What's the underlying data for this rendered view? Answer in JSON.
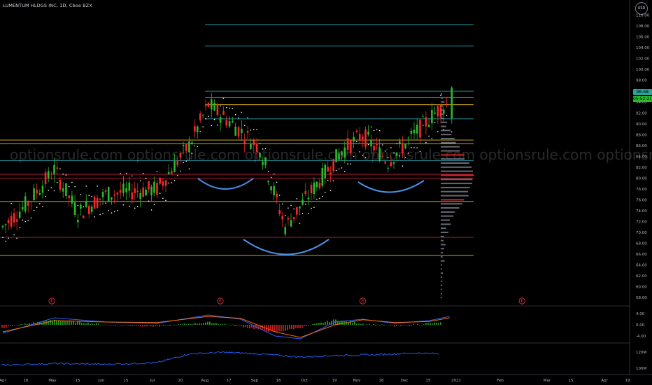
{
  "header": {
    "title": "LUMENTUM HLDGS INC, 1D, Cboe BZX",
    "currency": "USD"
  },
  "price_tags": {
    "last": "96.68",
    "countdown": "05:52:21"
  },
  "watermark": "optionsrule.com optionsrule.com optionsrule.com optionsrule.com optionsrule.com optionsrule.com opti",
  "colors": {
    "up": "#26a69a",
    "up_bright": "#2db92d",
    "down": "#ef2b2b",
    "macd_line": "#2962ff",
    "signal_line": "#ff6d00",
    "rsi_line": "#2962ff",
    "hline_cyan": "#21a5b3",
    "hline_yellow": "#f5c518",
    "hline_red": "#c41e3a",
    "hline_green": "#4caf50",
    "pattern_arc": "#4a8fe7",
    "volume_profile": "#787b86"
  },
  "chart_data": [
    {
      "type": "candlestick",
      "name": "main_price",
      "y_ticks": [
        "110.00",
        "108.00",
        "106.00",
        "104.00",
        "102.00",
        "100.00",
        "98.00",
        "96.00",
        "94.00",
        "92.00",
        "90.00",
        "88.00",
        "86.00",
        "84.00",
        "82.00",
        "80.00",
        "78.00",
        "76.00",
        "74.00",
        "72.00",
        "70.00",
        "68.00",
        "66.00",
        "64.00",
        "62.00",
        "60.00",
        "58.00"
      ],
      "ylim": [
        57,
        112
      ],
      "x_ticks": [
        "Apr",
        "16",
        "May",
        "15",
        "Jun",
        "15",
        "Jul",
        "20",
        "Aug",
        "17",
        "Sep",
        "16",
        "Oct",
        "19",
        "Nov",
        "16",
        "Dec",
        "15",
        "2021",
        "Feb",
        "Mar",
        "15",
        "Apr",
        "19"
      ],
      "ohlc_points": [
        {
          "date": "Apr 1",
          "open": 70,
          "close": 72
        },
        {
          "date": "Apr 16",
          "open": 73,
          "close": 78
        },
        {
          "date": "May 1",
          "open": 80,
          "close": 83
        },
        {
          "date": "May 15",
          "open": 75,
          "close": 72
        },
        {
          "date": "Jun 1",
          "open": 76,
          "close": 78
        },
        {
          "date": "Jun 15",
          "open": 78,
          "close": 77
        },
        {
          "date": "Jul 1",
          "open": 76,
          "close": 80
        },
        {
          "date": "Jul 20",
          "open": 84,
          "close": 88
        },
        {
          "date": "Aug 1",
          "open": 93,
          "close": 94
        },
        {
          "date": "Aug 17",
          "open": 91,
          "close": 88
        },
        {
          "date": "Sep 1",
          "open": 86,
          "close": 85
        },
        {
          "date": "Sep 16",
          "open": 72,
          "close": 70
        },
        {
          "date": "Oct 1",
          "open": 76,
          "close": 79
        },
        {
          "date": "Oct 19",
          "open": 84,
          "close": 86
        },
        {
          "date": "Nov 1",
          "open": 85,
          "close": 91
        },
        {
          "date": "Nov 16",
          "open": 84,
          "close": 82
        },
        {
          "date": "Dec 1",
          "open": 86,
          "close": 90
        },
        {
          "date": "Dec 15",
          "open": 93,
          "close": 92
        },
        {
          "date": "Dec 22",
          "open": 91,
          "close": 96.68
        }
      ],
      "horizontal_levels": [
        {
          "price": 108.2,
          "color": "cyan"
        },
        {
          "price": 104.3,
          "color": "cyan"
        },
        {
          "price": 96.0,
          "color": "cyan"
        },
        {
          "price": 94.8,
          "color": "green"
        },
        {
          "price": 93.5,
          "color": "yellow"
        },
        {
          "price": 90.9,
          "color": "cyan"
        },
        {
          "price": 87.0,
          "color": "yellow"
        },
        {
          "price": 86.3,
          "color": "yellow"
        },
        {
          "price": 83.2,
          "color": "cyan"
        },
        {
          "price": 80.7,
          "color": "red"
        },
        {
          "price": 80.0,
          "color": "red"
        },
        {
          "price": 75.7,
          "color": "yellow"
        },
        {
          "price": 69.1,
          "color": "red"
        },
        {
          "price": 65.8,
          "color": "yellow"
        }
      ],
      "earnings_markers": [
        {
          "date": "Apr 30",
          "label": "E"
        },
        {
          "date": "Aug 8",
          "label": "E"
        },
        {
          "date": "Nov 1",
          "label": "E"
        },
        {
          "date": "Feb 4",
          "label": "E"
        }
      ]
    },
    {
      "type": "bar+line",
      "name": "macd",
      "y_ticks": [
        "4.00",
        "0.00",
        "-4.00"
      ],
      "ylim": [
        -6,
        6
      ],
      "x": [
        "Apr 1",
        "May 1",
        "Jun 1",
        "Jul 1",
        "Aug 1",
        "Aug 20",
        "Sep 10",
        "Sep 25",
        "Oct 15",
        "Nov 1",
        "Nov 20",
        "Dec 10",
        "Dec 22"
      ],
      "series": [
        {
          "values": [
            -3.0,
            2.5,
            1.0,
            0.5,
            3.5,
            2.0,
            -4.0,
            -5.0,
            1.0,
            2.0,
            0.5,
            1.5,
            3.0
          ]
        },
        {
          "values": [
            -2.5,
            1.5,
            1.0,
            0.8,
            3.0,
            2.3,
            -2.5,
            -4.5,
            0.0,
            1.8,
            0.8,
            1.2,
            2.5
          ]
        }
      ]
    },
    {
      "type": "line",
      "name": "volume_oscillator",
      "y_ticks": [
        "120M",
        "100M"
      ],
      "ylim": [
        95,
        128
      ],
      "x": [
        "Apr 1",
        "May 1",
        "Jun 1",
        "Jul 1",
        "Jul 20",
        "Aug 10",
        "Sep 1",
        "Sep 25",
        "Oct 15",
        "Nov 10",
        "Dec 1",
        "Dec 22"
      ],
      "values": [
        104,
        106,
        105,
        107,
        118,
        120,
        118,
        114,
        116,
        117,
        119,
        118
      ]
    }
  ]
}
